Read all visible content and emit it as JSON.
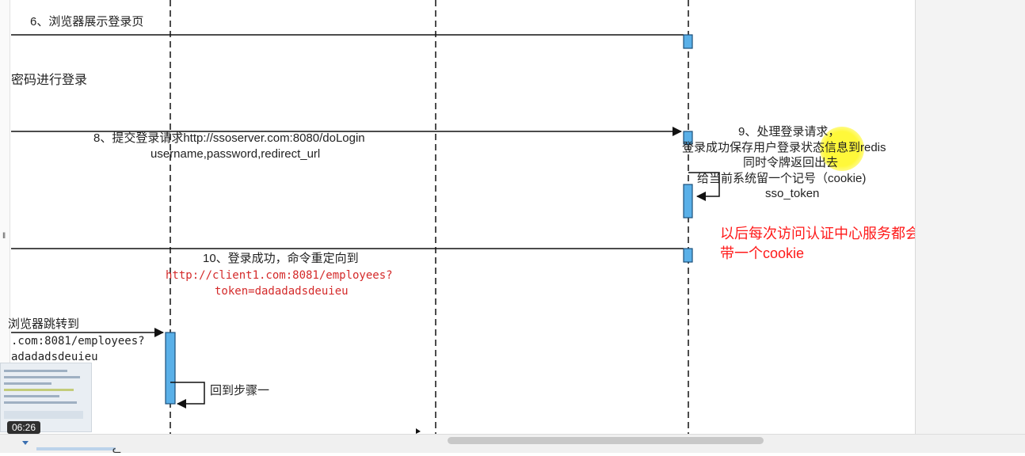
{
  "messages": {
    "step6": "6、浏览器展示登录页",
    "step7": "密码进行登录",
    "step8_line1": "8、提交登录请求http://ssoserver.com:8080/doLogin",
    "step8_line2": "username,password,redirect_url",
    "step9_line1": "9、处理登录请求，",
    "step9_line2": "登录成功保存用户登录状态信息到redis",
    "step9_line3": "同时令牌返回出去",
    "step9_line4": "给当前系统留一个记号（cookie)",
    "step9_line5": "sso_token",
    "step10_line1": "10、登录成功，命令重定向到",
    "step10_url": "http://client1.com:8081/employees?",
    "step10_token": "token=dadadadsdeuieu",
    "step11_line1": "浏览器跳转到",
    "step11_line2": ".com:8081/employees?",
    "step11_line3": "adadadsdeuieu",
    "back_to_step1": "回到步骤一"
  },
  "note": {
    "line1": "以后每次访问认证中心服务都会",
    "line2": "带一个cookie",
    "color": "#ff1a1a"
  },
  "player": {
    "timestamp": "06:26"
  },
  "colors": {
    "activation": "#5ab0e8",
    "url_red": "#d42a2a",
    "line": "#111111"
  }
}
